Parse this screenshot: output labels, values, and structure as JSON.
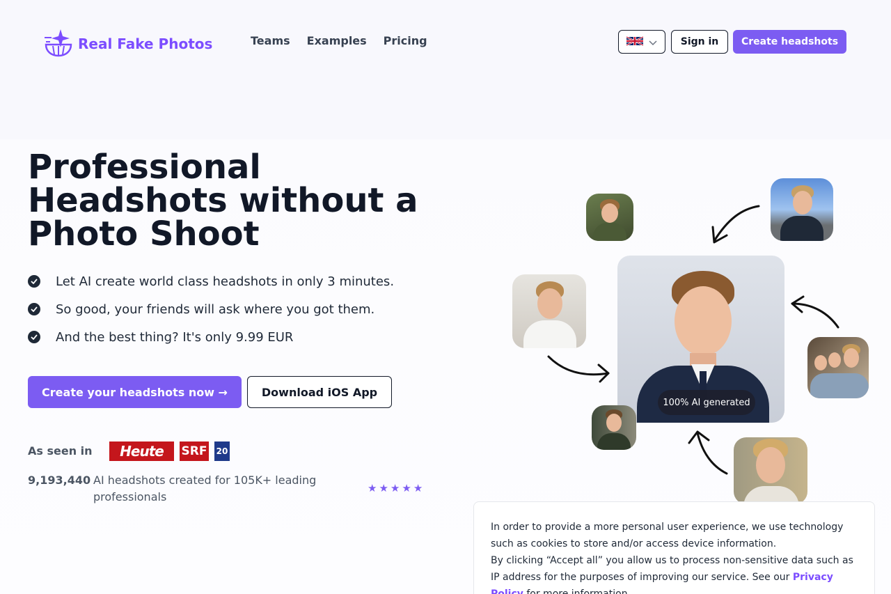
{
  "header": {
    "brand": "Real Fake Photos",
    "nav": [
      "Teams",
      "Examples",
      "Pricing"
    ],
    "sign_in": "Sign in",
    "create": "Create headshots"
  },
  "hero": {
    "headline": "Professional Headshots without a Photo Shoot",
    "bullets": [
      "Let AI create world class headshots in only 3 minutes.",
      "So good, your friends will ask where you got them.",
      "And the best thing? It's only 9.99 EUR"
    ],
    "cta_primary": "Create your headshots now →",
    "cta_secondary": "Download iOS App",
    "seen_in_label": "As seen in",
    "press_logos": [
      "Heute",
      "SRF",
      "20"
    ],
    "stat_count": "9,193,440",
    "stat_text": "AI headshots created for 105K+ leading professionals",
    "rating_stars": 5
  },
  "collage": {
    "badge": "100% AI generated"
  },
  "cookie": {
    "line1": "In order to provide a more personal user experience, we use technology such as cookies to store and/or access device information.",
    "line2_prefix": "By clicking “Accept all” you allow us to process non-sensitive data such as IP address for the purposes of improving our service. See our ",
    "link": "Privacy Policy",
    "line2_suffix": " for more information."
  },
  "colors": {
    "accent": "#7c5cf2",
    "brand": "#7c4dff",
    "press_red": "#c4161c",
    "press_blue": "#1f3a8a"
  },
  "icons": [
    "logo-sparkle-icon",
    "uk-flag-icon",
    "chevron-down-icon",
    "check-icon",
    "star-icon",
    "arrow-icon"
  ]
}
